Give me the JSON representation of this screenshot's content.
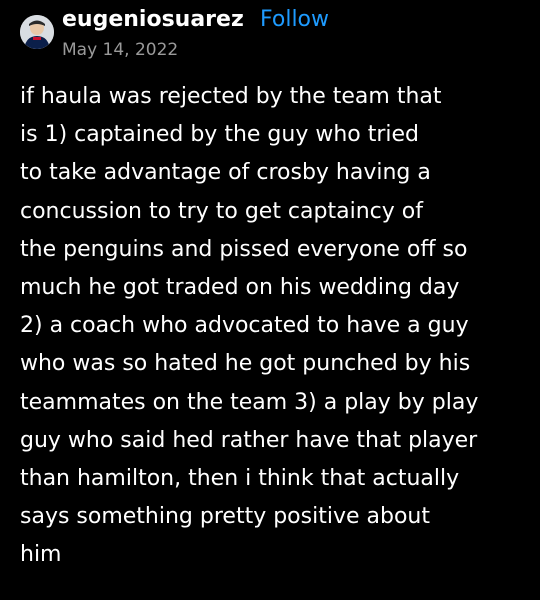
{
  "post": {
    "author": "eugeniosuarez",
    "follow_label": "Follow",
    "date": "May 14, 2022",
    "body": "if haula was rejected by the team that\nis 1) captained by the guy who tried\nto take advantage of crosby having a\nconcussion to try to get captaincy of\nthe penguins and pissed everyone off so\nmuch he got traded on his wedding day\n2) a coach who advocated to have a guy\nwho was so hated he got punched by his\nteammates on the team 3) a play by play\nguy who said hed rather have that player\nthan hamilton, then i think that actually\nsays something pretty positive about\nhim"
  },
  "colors": {
    "background": "#000000",
    "text": "#ffffff",
    "follow_accent": "#1e9bff",
    "date": "#9a9a9a"
  },
  "icons": {
    "avatar": "avatar-photo"
  }
}
